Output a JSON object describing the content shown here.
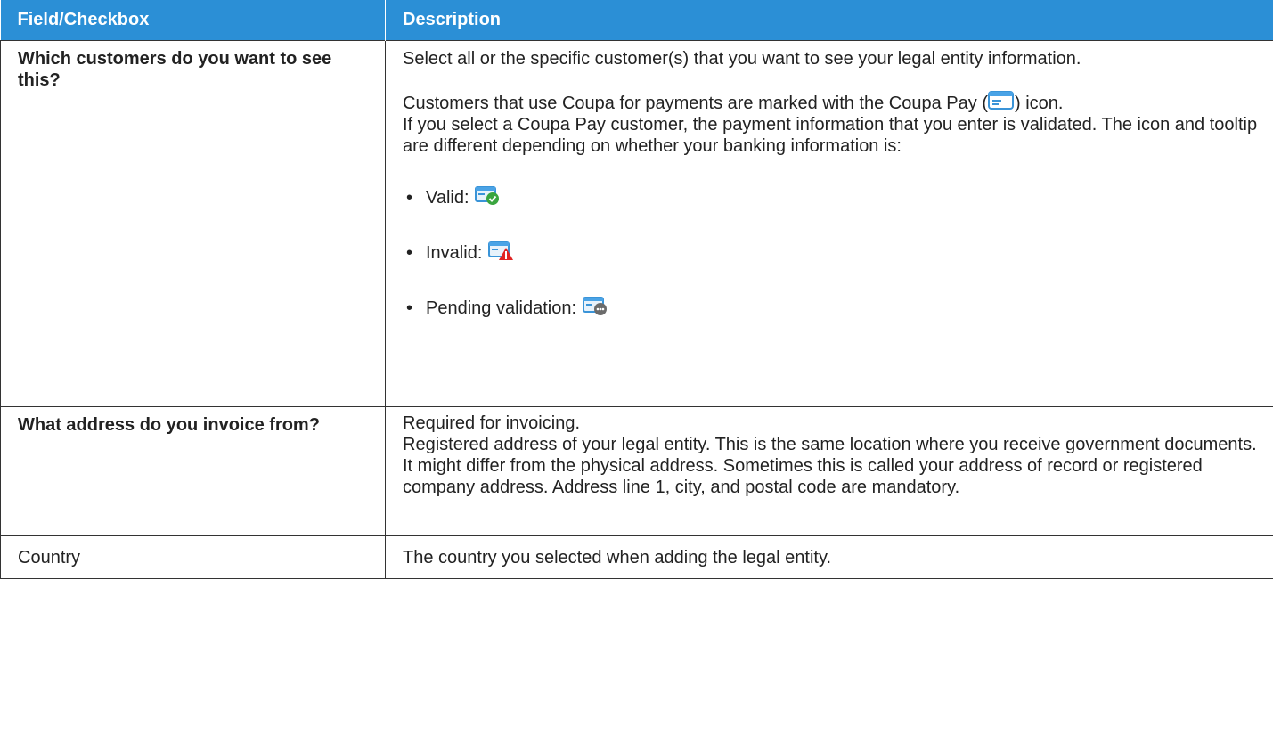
{
  "table": {
    "headers": [
      "Field/Checkbox",
      "Description"
    ],
    "colors": {
      "header_bg": "#2b8fd6",
      "header_text": "#ffffff",
      "border": "#333333"
    },
    "rows": [
      {
        "field": "Which customers do you want to see this?",
        "desc_p1": "Select all or the specific customer(s) that you want to see your legal entity information.",
        "desc_p2_before_icon": "Customers that use Coupa for payments are marked with the Coupa Pay (",
        "desc_p2_after_icon": ") icon.",
        "coupa_pay_icon": "coupa-pay-card-icon",
        "desc_p3": "If you select a Coupa Pay customer, the payment information that you enter is validated. The icon and tooltip are different depending on whether your banking information is:",
        "statuses": [
          {
            "label": "Valid:",
            "icon": "card-valid-check-icon"
          },
          {
            "label": "Invalid:",
            "icon": "card-invalid-warning-icon"
          },
          {
            "label": "Pending validation:",
            "icon": "card-pending-dots-icon"
          }
        ]
      },
      {
        "field": "What address do you invoice from?",
        "desc_lines": [
          "Required for invoicing.",
          "Registered address of your legal entity. This is the same location where you receive government documents. It might differ from the physical address. Sometimes this is called your address of record or registered company address. Address line 1, city, and postal code are mandatory."
        ]
      },
      {
        "field": "Country",
        "desc": "The country you selected when adding the legal entity."
      }
    ]
  }
}
